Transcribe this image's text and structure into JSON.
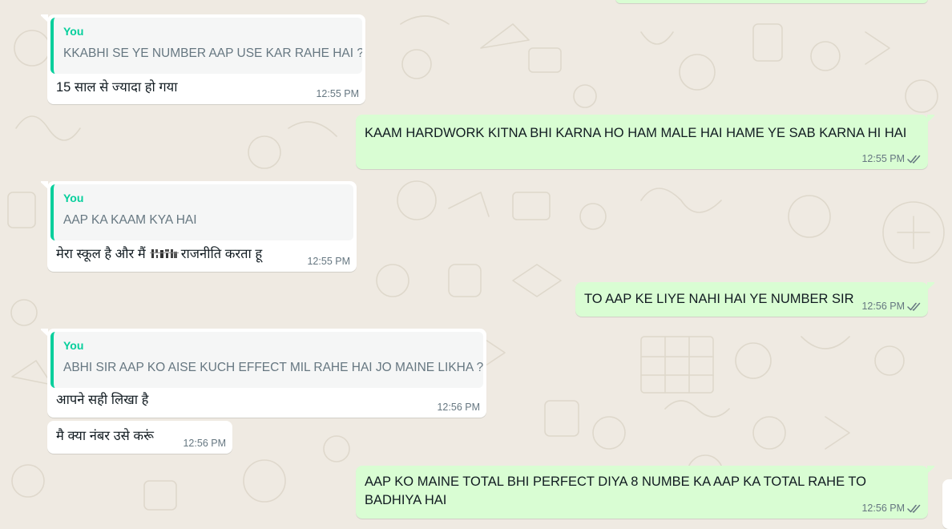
{
  "chat": {
    "theme": {
      "background": "#efeae2",
      "incoming_bubble": "#ffffff",
      "outgoing_bubble": "#d9fdd3",
      "quote_accent": "#06cf9c",
      "read_tick_color": "#667781"
    },
    "messages": [
      {
        "direction": "incoming",
        "quoted_author": "You",
        "quoted_text": "KKABHI SE YE NUMBER AAP USE KAR RAHE HAI ?",
        "text": "15 साल से ज्यादा हो गया",
        "time": "12:55 PM"
      },
      {
        "direction": "outgoing",
        "text": "KAAM HARDWORK KITNA BHI KARNA HO HAM MALE HAI HAME YE SAB KARNA HI HAI",
        "time": "12:55 PM",
        "status": "read-double-tick"
      },
      {
        "direction": "incoming",
        "quoted_author": "You",
        "quoted_text": "AAP KA KAAM KYA HAI",
        "text_before": "मेरा स्कूल है और मैं",
        "text_after": "राजनीति करता हू",
        "time": "12:55 PM"
      },
      {
        "direction": "outgoing",
        "text": "TO AAP KE LIYE NAHI HAI YE NUMBER SIR",
        "time": "12:56 PM",
        "status": "read-double-tick"
      },
      {
        "direction": "incoming",
        "quoted_author": "You",
        "quoted_text": "ABHI SIR AAP KO AISE KUCH EFFECT MIL RAHE HAI JO MAINE LIKHA ?",
        "text": "आपने सही लिखा है",
        "time": "12:56 PM"
      },
      {
        "direction": "incoming",
        "text": "मै क्या नंबर उसे करूं",
        "time": "12:56 PM"
      },
      {
        "direction": "outgoing",
        "text": "AAP KO MAINE TOTAL BHI PERFECT DIYA 8 NUMBE KA AAP KA TOTAL RAHE TO BADHIYA HAI",
        "time": "12:56 PM",
        "status": "read-double-tick"
      }
    ]
  }
}
